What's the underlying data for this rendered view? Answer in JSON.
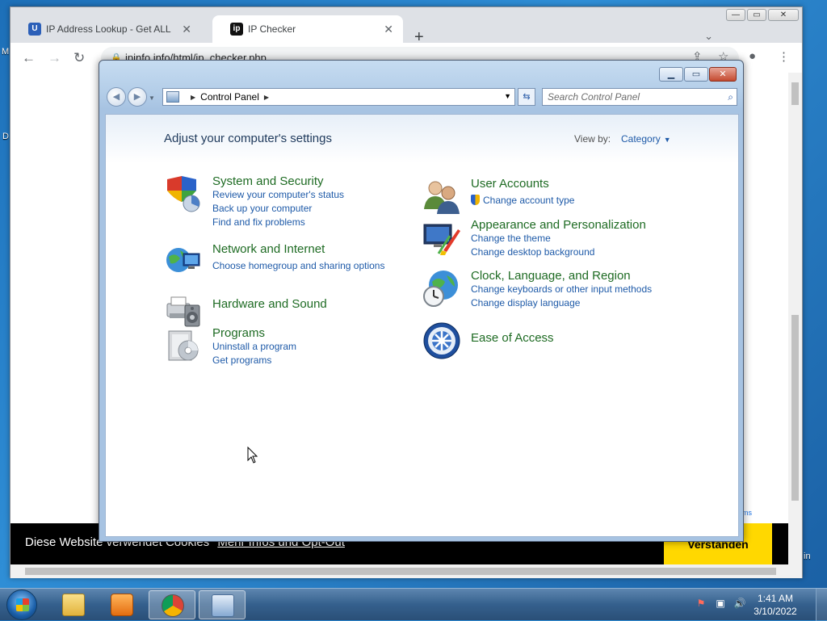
{
  "desktop": {
    "frag_left_1": "M",
    "frag_left_2": "D",
    "frag_right_1": "in"
  },
  "chrome": {
    "tabs": [
      {
        "label": "IP Address Lookup - Get ALL IP L",
        "icon_text": "U",
        "icon_color": "#2b5fb8"
      },
      {
        "label": "IP Checker",
        "icon_text": "ip",
        "icon_color": "#111111"
      }
    ],
    "new_tab": "+",
    "url": "ipinfo.info/html/ip_checker.php",
    "cookie": {
      "text": "Diese Website verwendet Cookies",
      "link": "Mehr Infos und Opt-Out",
      "accept": "Verstanden"
    },
    "behind_frag": "ms"
  },
  "control_panel": {
    "breadcrumb": "Control Panel",
    "search_placeholder": "Search Control Panel",
    "heading": "Adjust your computer's settings",
    "view_by_label": "View by:",
    "view_by_value": "Category",
    "left_categories": [
      {
        "title": "System and Security",
        "links": [
          "Review your computer's status",
          "Back up your computer",
          "Find and fix problems"
        ]
      },
      {
        "title": "Network and Internet",
        "links": [
          "Choose homegroup and sharing options"
        ]
      },
      {
        "title": "Hardware and Sound",
        "links": []
      },
      {
        "title": "Programs",
        "links": [
          "Uninstall a program",
          "Get programs"
        ]
      }
    ],
    "right_categories": [
      {
        "title": "User Accounts",
        "links": [
          "Change account type"
        ]
      },
      {
        "title": "Appearance and Personalization",
        "links": [
          "Change the theme",
          "Change desktop background"
        ]
      },
      {
        "title": "Clock, Language, and Region",
        "links": [
          "Change keyboards or other input methods",
          "Change display language"
        ]
      },
      {
        "title": "Ease of Access",
        "links": []
      }
    ]
  },
  "taskbar": {
    "time": "1:41 AM",
    "date": "3/10/2022",
    "accent": "#35608d"
  }
}
